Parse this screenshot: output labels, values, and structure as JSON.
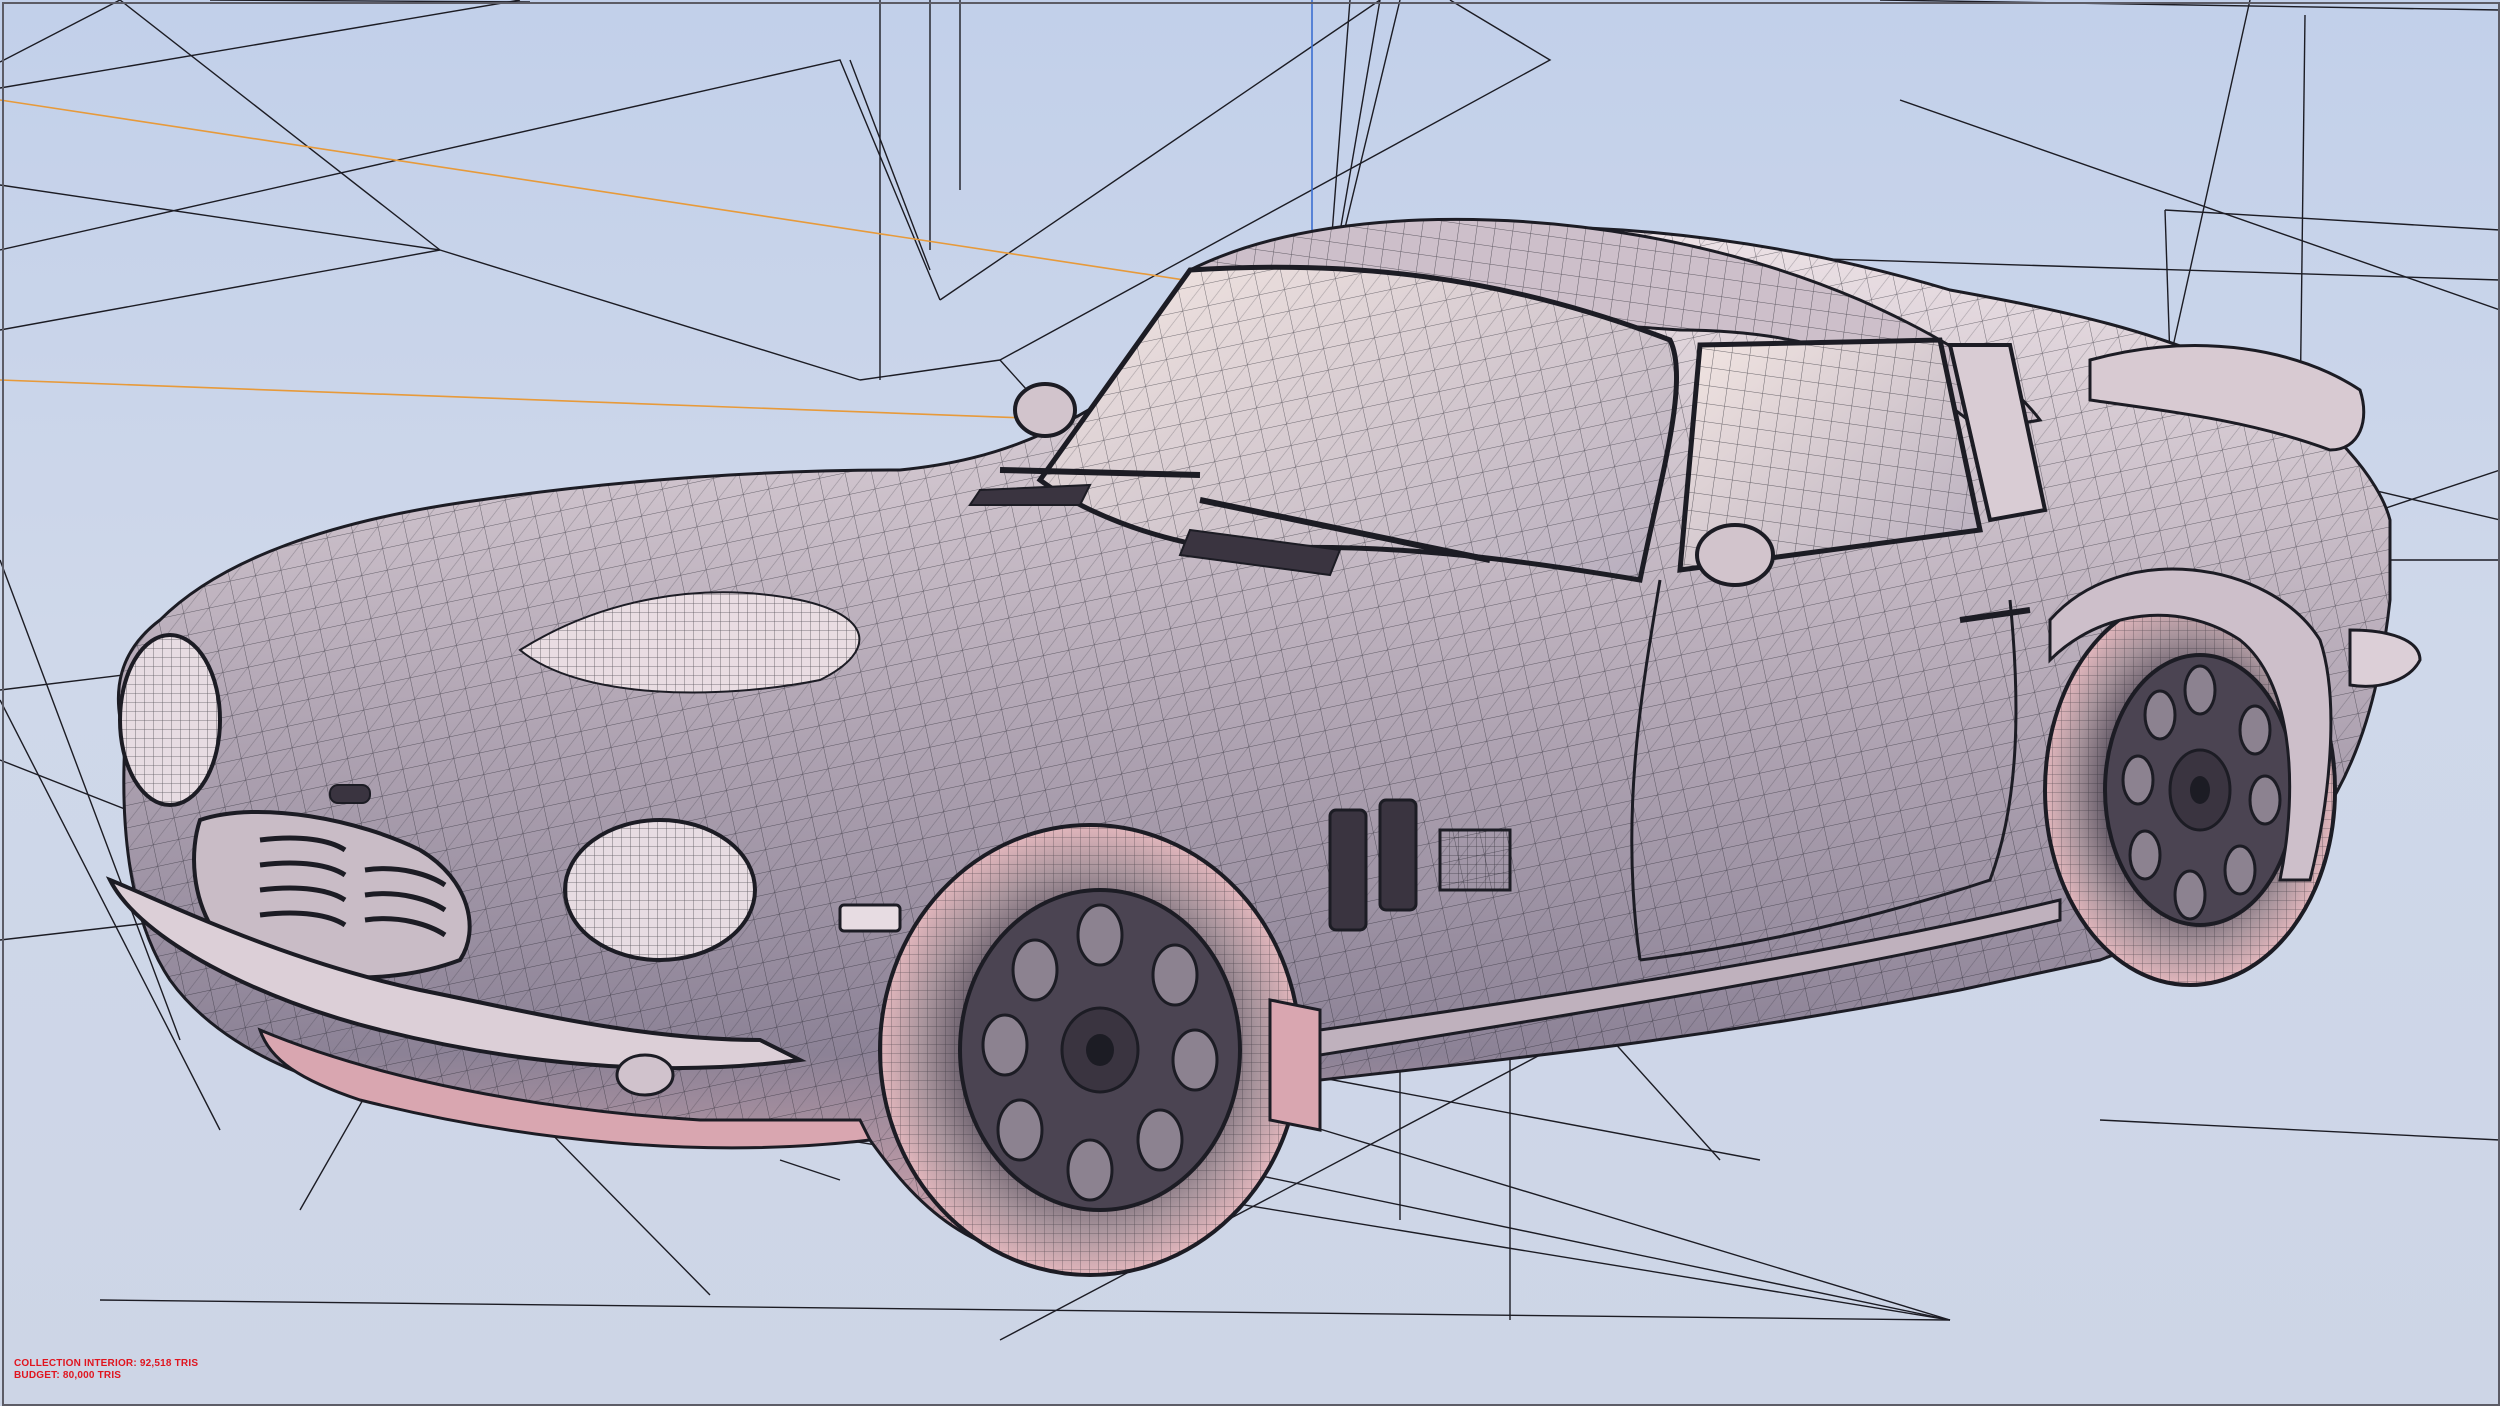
{
  "overlay": {
    "collection_line": "COLLECTION INTERIOR: 92,518 TRIS",
    "budget_line": "BUDGET: 80,000 TRIS"
  },
  "colors": {
    "viewport_bg": "#c9d4e6",
    "wire": "#1c1c24",
    "guide_orange": "#e79a3a",
    "guide_blue": "#3b6fd0",
    "body_shade": "#a79aa8",
    "stats_text": "#e0141e"
  }
}
